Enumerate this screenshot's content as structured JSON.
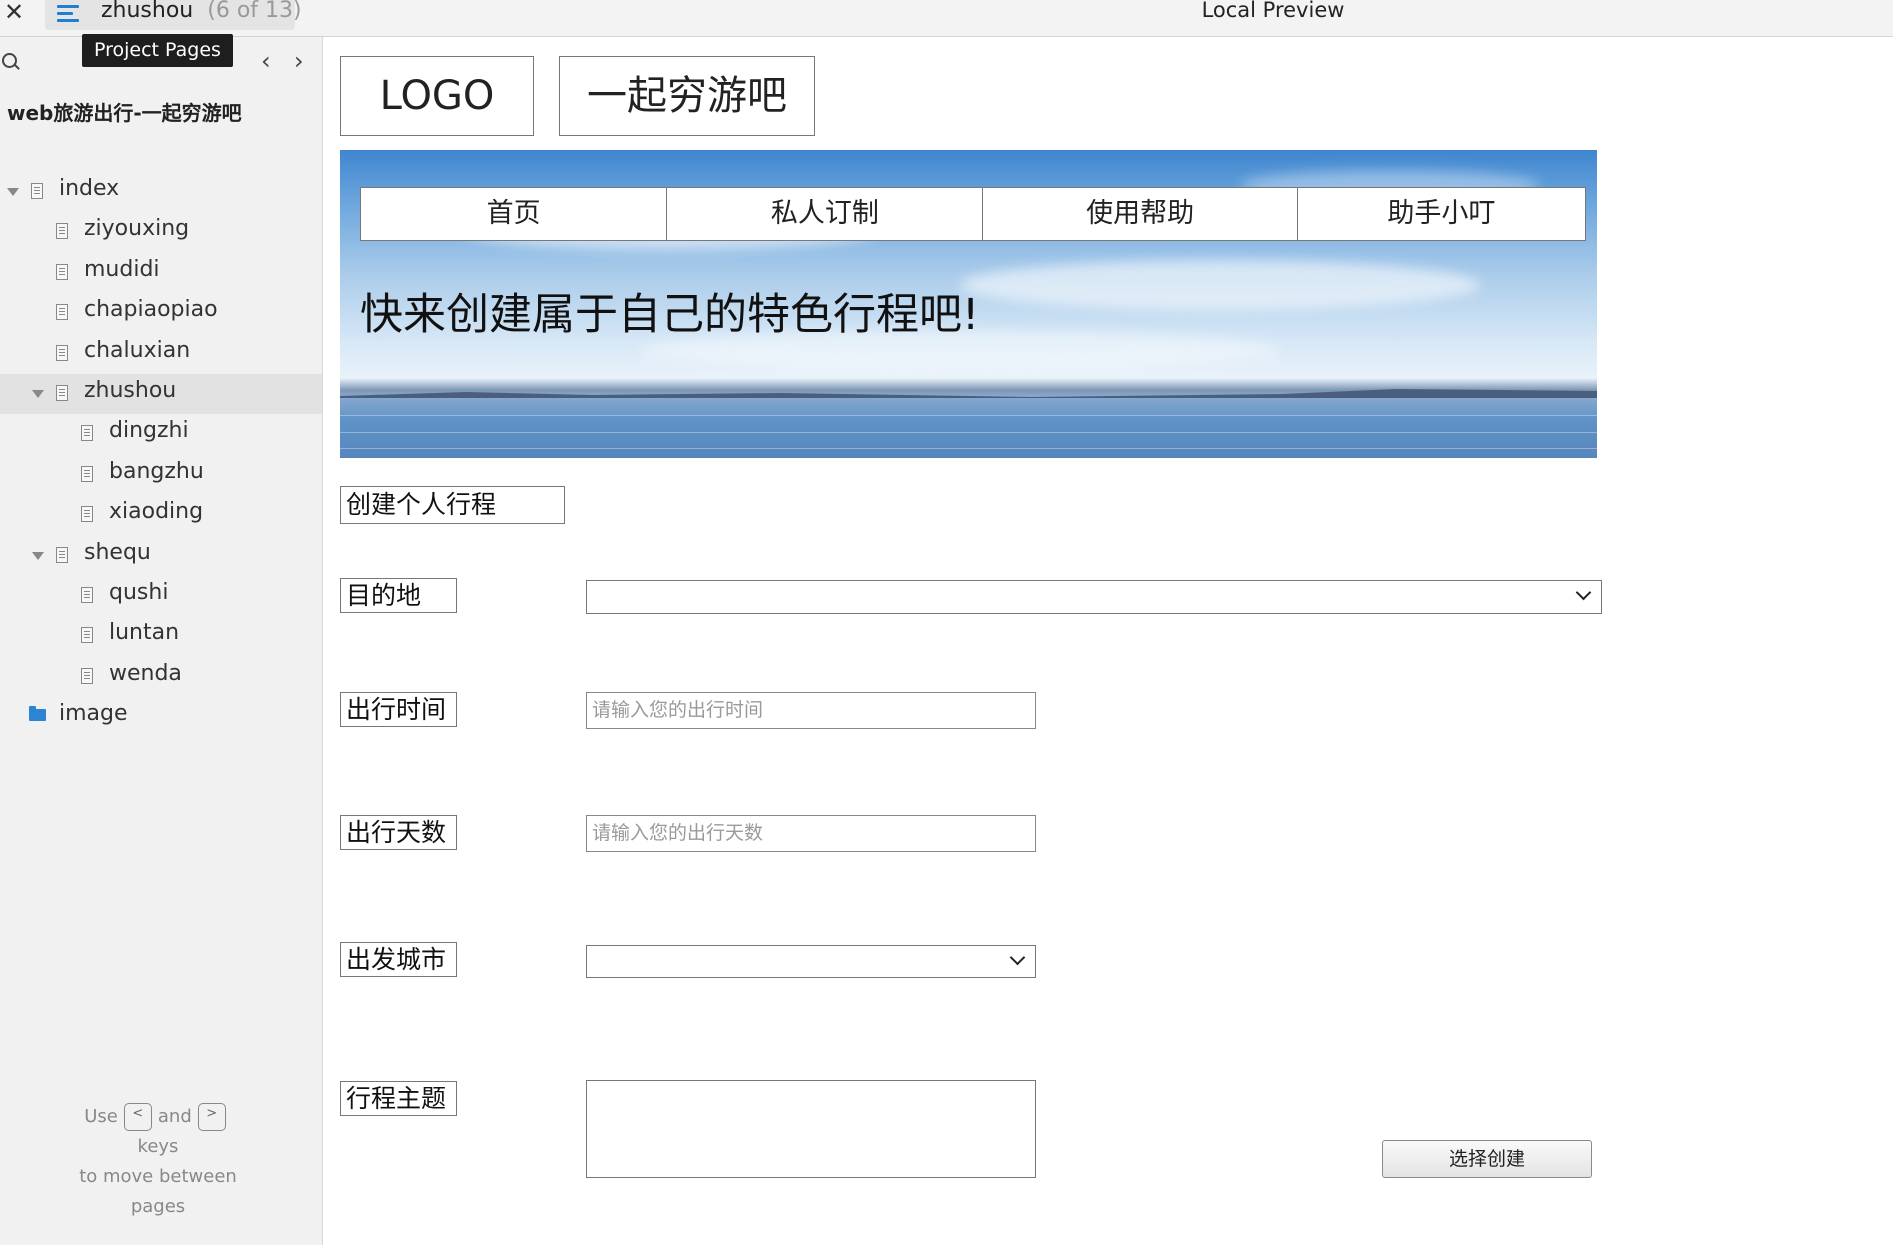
{
  "topbar": {
    "page_name": "zhushou",
    "page_count": "(6 of 13)",
    "preview_title": "Local Preview"
  },
  "sidebar": {
    "tooltip": "Project Pages",
    "project_title": "web旅游出行-一起穷游吧",
    "tree": [
      {
        "label": "index",
        "level": 0,
        "expanded": true,
        "type": "page"
      },
      {
        "label": "ziyouxing",
        "level": 1,
        "type": "page"
      },
      {
        "label": "mudidi",
        "level": 1,
        "type": "page"
      },
      {
        "label": "chapiaopiao",
        "level": 1,
        "type": "page"
      },
      {
        "label": "chaluxian",
        "level": 1,
        "type": "page"
      },
      {
        "label": "zhushou",
        "level": 1,
        "expanded": true,
        "selected": true,
        "type": "page"
      },
      {
        "label": "dingzhi",
        "level": 2,
        "type": "page"
      },
      {
        "label": "bangzhu",
        "level": 2,
        "type": "page"
      },
      {
        "label": "xiaoding",
        "level": 2,
        "type": "page"
      },
      {
        "label": "shequ",
        "level": 1,
        "expanded": true,
        "type": "page"
      },
      {
        "label": "qushi",
        "level": 2,
        "type": "page"
      },
      {
        "label": "luntan",
        "level": 2,
        "type": "page"
      },
      {
        "label": "wenda",
        "level": 2,
        "type": "page"
      },
      {
        "label": "image",
        "level": 0,
        "type": "folder"
      }
    ],
    "hint": {
      "use": "Use",
      "and": "and",
      "keys": "keys",
      "line2": "to move between",
      "line3": "pages",
      "key_prev": "<",
      "key_next": ">"
    }
  },
  "header": {
    "logo": "LOGO",
    "site_name": "一起穷游吧"
  },
  "banner": {
    "nav": [
      "首页",
      "私人订制",
      "使用帮助",
      "助手小叮"
    ],
    "slogan": "快来创建属于自己的特色行程吧!"
  },
  "form": {
    "title": "创建个人行程",
    "destination_label": "目的地",
    "destination_value": "",
    "time_label": "出行时间",
    "time_placeholder": "请输入您的出行时间",
    "days_label": "出行天数",
    "days_placeholder": "请输入您的出行天数",
    "city_label": "出发城市",
    "city_value": "",
    "theme_label": "行程主题",
    "submit_label": "选择创建"
  },
  "colors": {
    "accent": "#1f7fd6",
    "sidebar_bg": "#f1f1f1",
    "selected_row": "#e2e2e2"
  }
}
